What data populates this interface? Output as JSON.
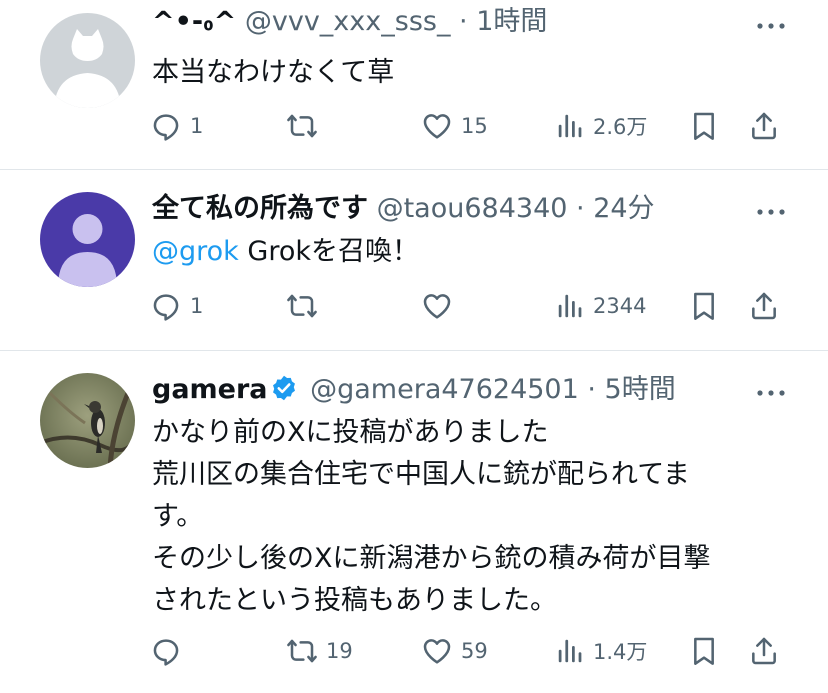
{
  "tweets": [
    {
      "display_name": "^•-៰^",
      "handle": "@vvv_xxx_sss_",
      "time": "1時間",
      "text_lines": [
        "本当なわけなくて草"
      ],
      "reply_count": "1",
      "retweet_count": "",
      "like_count": "15",
      "view_count": "2.6万"
    },
    {
      "display_name": "全て私の所為です",
      "handle": "@taou684340",
      "time": "24分",
      "mention": "@grok",
      "text": " Grokを召喚！",
      "reply_count": "1",
      "retweet_count": "",
      "like_count": "",
      "view_count": "2344"
    },
    {
      "display_name": "gamera",
      "verified": true,
      "handle": "@gamera47624501",
      "time": "5時間",
      "text_lines": [
        "かなり前のXに投稿がありました",
        "荒川区の集合住宅で中国人に銃が配られてま",
        "す。",
        "その少し後のXに新潟港から銃の積み荷が目撃",
        "されたという投稿もありました。"
      ],
      "reply_count": "",
      "retweet_count": "19",
      "like_count": "59",
      "view_count": "1.4万"
    }
  ],
  "separator": " · ",
  "icons": {
    "reply": "reply-icon",
    "retweet": "retweet-icon",
    "like": "heart-icon",
    "views": "views-icon",
    "bookmark": "bookmark-icon",
    "share": "share-icon",
    "more": "more-icon",
    "verified": "verified-badge-icon"
  },
  "colors": {
    "text": "#0f1419",
    "secondary": "#536471",
    "link": "#1d9bf0",
    "verified": "#1d9bf0",
    "avatar2_bg": "#4a3aa8"
  }
}
